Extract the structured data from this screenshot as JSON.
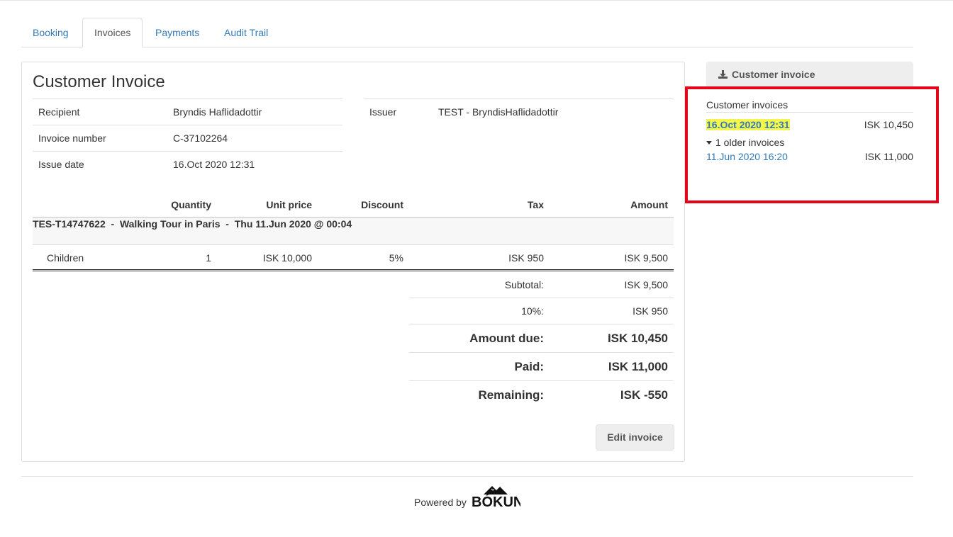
{
  "tabs": [
    {
      "label": "Booking",
      "active": false
    },
    {
      "label": "Invoices",
      "active": true
    },
    {
      "label": "Payments",
      "active": false
    },
    {
      "label": "Audit Trail",
      "active": false
    }
  ],
  "invoice": {
    "title": "Customer Invoice",
    "recipient_label": "Recipient",
    "recipient": "Bryndis Haflidadottir",
    "number_label": "Invoice number",
    "number": "C-37102264",
    "date_label": "Issue date",
    "date": "16.Oct 2020 12:31",
    "issuer_label": "Issuer",
    "issuer": "TEST - BryndisHaflidadottir"
  },
  "lines": {
    "headers": {
      "quantity": "Quantity",
      "unit_price": "Unit price",
      "discount": "Discount",
      "tax": "Tax",
      "amount": "Amount"
    },
    "group": "TES-T14747622  -  Walking Tour in Paris  -  Thu 11.Jun 2020 @ 00:04",
    "rows": [
      {
        "item": "Children",
        "quantity": "1",
        "unit_price": "ISK 10,000",
        "discount": "5%",
        "tax": "ISK 950",
        "amount": "ISK 9,500"
      }
    ]
  },
  "summary": {
    "subtotal_label": "Subtotal:",
    "subtotal": "ISK 9,500",
    "tax_label": "10%:",
    "tax": "ISK 950",
    "due_label": "Amount due:",
    "due": "ISK 10,450",
    "paid_label": "Paid:",
    "paid": "ISK 11,000",
    "remaining_label": "Remaining:",
    "remaining": "ISK -550"
  },
  "edit_button": "Edit invoice",
  "sidebar": {
    "download_label": "Customer invoice",
    "heading": "Customer invoices",
    "current": {
      "date": "16.Oct 2020 12:31",
      "amount": "ISK 10,450"
    },
    "older_toggle": "1 older invoices",
    "older": [
      {
        "date": "11.Jun 2020 16:20",
        "amount": "ISK 11,000"
      }
    ]
  },
  "footer": {
    "powered_by": "Powered by",
    "brand": "BÓKUN"
  },
  "colors": {
    "link": "#337ab7",
    "highlight": "#f6f64a",
    "annotation_border": "#e3061b"
  },
  "icons": {
    "download": "download-icon",
    "caret": "caret-down-icon"
  }
}
